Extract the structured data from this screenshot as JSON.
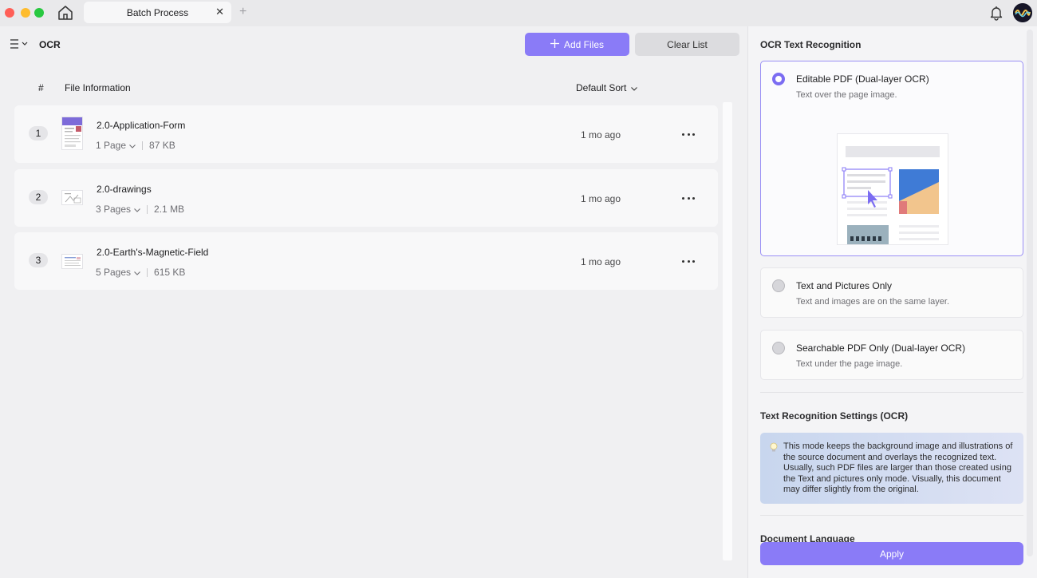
{
  "tab": {
    "title": "Batch Process",
    "close": "✕",
    "add": "+"
  },
  "toolbar": {
    "title": "OCR",
    "add_files": "Add Files",
    "clear_list": "Clear List"
  },
  "table": {
    "col_number": "#",
    "col_info": "File Information",
    "sort_label": "Default Sort"
  },
  "files": [
    {
      "index": "1",
      "name": "2.0-Application-Form",
      "pages": "1 Page",
      "size": "87 KB",
      "time": "1 mo ago"
    },
    {
      "index": "2",
      "name": "2.0-drawings",
      "pages": "3 Pages",
      "size": "2.1 MB",
      "time": "1 mo ago"
    },
    {
      "index": "3",
      "name": "2.0-Earth's-Magnetic-Field",
      "pages": "5 Pages",
      "size": "615 KB",
      "time": "1 mo ago"
    }
  ],
  "ocr": {
    "title": "OCR Text Recognition",
    "options": [
      {
        "title": "Editable PDF (Dual-layer OCR)",
        "desc": "Text over the page image.",
        "selected": true
      },
      {
        "title": "Text and Pictures Only",
        "desc": "Text and images are on the same layer.",
        "selected": false
      },
      {
        "title": "Searchable PDF Only (Dual-layer OCR)",
        "desc": "Text under the page image.",
        "selected": false
      }
    ],
    "settings_title": "Text Recognition Settings (OCR)",
    "info_text": "This mode keeps the background image and illustrations of the source document and overlays the recognized text. Usually, such PDF files are larger than those created using the Text and pictures only mode. Visually, this document may differ slightly from the original.",
    "language_label": "Document Language",
    "apply": "Apply"
  },
  "colors": {
    "accent": "#8a7bf7",
    "radio_on": "#7b6cf2"
  }
}
